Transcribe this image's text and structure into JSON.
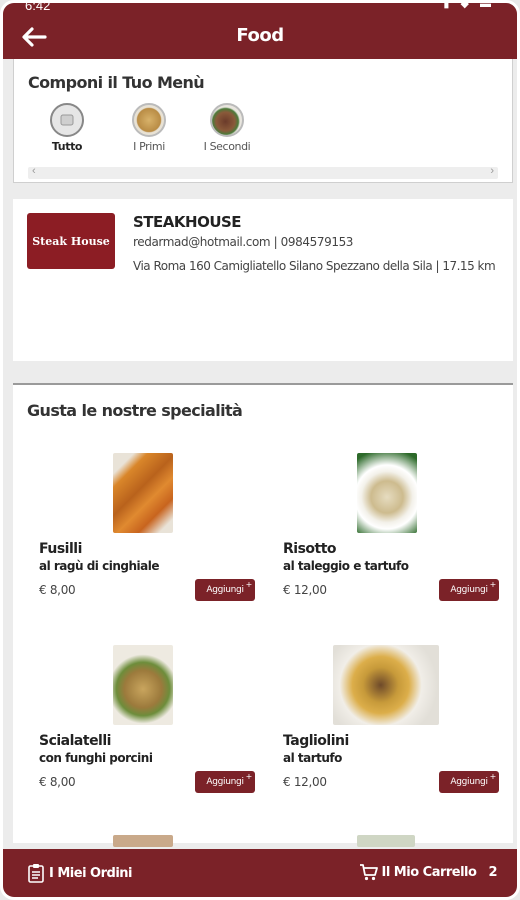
{
  "status": {
    "time": "6:42"
  },
  "header": {
    "title": "Food",
    "back_icon": "arrow-left-icon"
  },
  "menu": {
    "title": "Componi il Tuo Menù",
    "categories": [
      {
        "label": "Tutto",
        "active": true
      },
      {
        "label": "I Primi",
        "active": false
      },
      {
        "label": "I Secondi",
        "active": false
      }
    ]
  },
  "restaurant": {
    "logo_text": "Steak House",
    "name": "STEAKHOUSE",
    "contact": "redarmad@hotmail.com | 0984579153",
    "address": "Via Roma 160 Camigliatello Silano Spezzano della Sila | 17.15 km"
  },
  "specialties": {
    "title": "Gusta le nostre specialità",
    "dishes": [
      {
        "name": "Fusilli",
        "subtitle": "al ragù di cinghiale",
        "price": "€ 8,00",
        "button": "Aggiungi"
      },
      {
        "name": "Risotto",
        "subtitle": "al taleggio e tartufo",
        "price": "€ 12,00",
        "button": "Aggiungi"
      },
      {
        "name": "Scialatelli",
        "subtitle": "con funghi porcini",
        "price": "€ 8,00",
        "button": "Aggiungi"
      },
      {
        "name": "Tagliolini",
        "subtitle": "al tartufo",
        "price": "€ 12,00",
        "button": "Aggiungi"
      }
    ]
  },
  "bottom": {
    "orders_label": "I Miei Ordini",
    "cart_label": "Il Mio Carrello",
    "cart_count": "2"
  },
  "colors": {
    "brand": "#7b2228"
  }
}
